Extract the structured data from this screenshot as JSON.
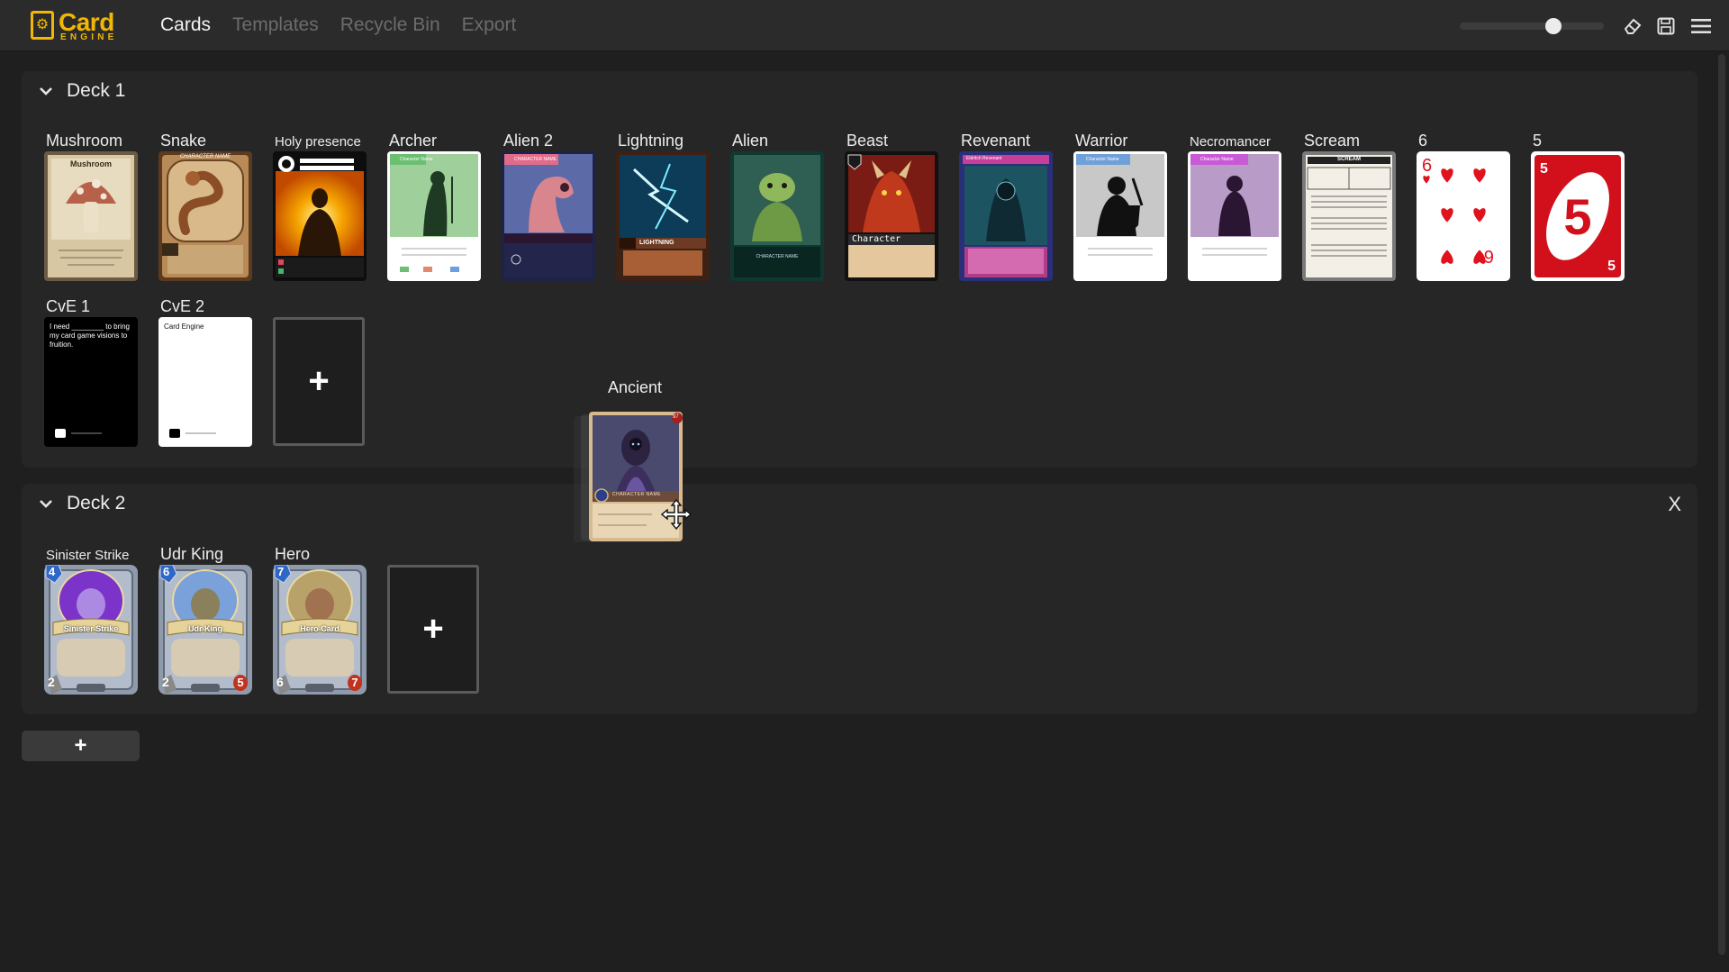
{
  "app": {
    "logo_main": "Card",
    "logo_sub": "ENGINE"
  },
  "nav": {
    "items": [
      {
        "label": "Cards",
        "active": true
      },
      {
        "label": "Templates",
        "active": false
      },
      {
        "label": "Recycle Bin",
        "active": false
      },
      {
        "label": "Export",
        "active": false
      }
    ]
  },
  "zoom": {
    "level": 0.65
  },
  "header_icons": [
    "eraser-icon",
    "save-icon",
    "menu-icon"
  ],
  "decks": [
    {
      "title": "Deck 1",
      "cards": [
        {
          "label": "Mushroom",
          "art": "mushroom",
          "text": "Mushroom"
        },
        {
          "label": "Snake",
          "art": "snake",
          "text": "CHARACTER NAME"
        },
        {
          "label": "Holy presence",
          "art": "holy",
          "text": "HOLY PRESENCE"
        },
        {
          "label": "Archer",
          "art": "archer",
          "text": "Character Name"
        },
        {
          "label": "Alien 2",
          "art": "alien2",
          "text": "CHARACTER NAME"
        },
        {
          "label": "Lightning",
          "art": "lightning",
          "text": "LIGHTNING"
        },
        {
          "label": "Alien",
          "art": "alien",
          "text": "CHARACTER NAME"
        },
        {
          "label": "Beast",
          "art": "beast",
          "text": "Character"
        },
        {
          "label": "Revenant",
          "art": "revenant",
          "text": "Eldritch Revenant"
        },
        {
          "label": "Warrior",
          "art": "warrior",
          "text": "Character Name"
        },
        {
          "label": "Necromancer",
          "art": "necro",
          "text": "Character Name"
        },
        {
          "label": "Scream",
          "art": "scream",
          "text": "SCREAM"
        },
        {
          "label": "6",
          "art": "six",
          "text": "6"
        },
        {
          "label": "5",
          "art": "five",
          "text": "5"
        },
        {
          "label": "CvE 1",
          "art": "cve1",
          "text": "I need ________ to bring my card game visions to fruition."
        },
        {
          "label": "CvE 2",
          "art": "cve2",
          "text": "Card Engine"
        }
      ]
    },
    {
      "title": "Deck 2",
      "cards": [
        {
          "label": "Sinister Strike",
          "art": "sinister",
          "text": "Sinister Strike",
          "mana": "4",
          "attack": "2",
          "health": ""
        },
        {
          "label": "Udr King",
          "art": "udr",
          "text": "Udr King",
          "mana": "6",
          "attack": "2",
          "health": "5"
        },
        {
          "label": "Hero",
          "art": "hero",
          "text": "Hero Card",
          "mana": "7",
          "attack": "6",
          "health": "7"
        }
      ]
    }
  ],
  "dragging": {
    "label": "Ancient",
    "text": "CHARACTER NAME",
    "badge": "97"
  },
  "add_deck_label": "+",
  "add_card_label": "+",
  "close_label": "X"
}
